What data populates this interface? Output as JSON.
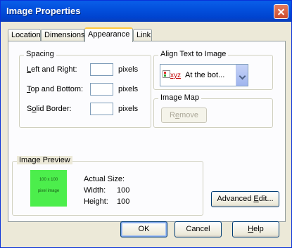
{
  "window": {
    "title": "Image Properties"
  },
  "tabs": [
    {
      "label": "Location",
      "active": false
    },
    {
      "label": "Dimensions",
      "active": false
    },
    {
      "label": "Appearance",
      "active": true
    },
    {
      "label": "Link",
      "active": false
    }
  ],
  "spacing": {
    "title": "Spacing",
    "left_right": {
      "label_ul": "L",
      "label_rest": "eft and Right:",
      "value": "",
      "unit": "pixels"
    },
    "top_bottom": {
      "label_ul": "T",
      "label_rest": "op and Bottom:",
      "value": "",
      "unit": "pixels"
    },
    "solid_border": {
      "label_pre": "S",
      "label_ul": "o",
      "label_rest": "lid Border:",
      "value": "",
      "unit": "pixels"
    }
  },
  "align": {
    "title": "Align Text to Image",
    "icon_text": "xyz",
    "selected": "At the bot..."
  },
  "image_map": {
    "title": "Image Map",
    "remove_pre": "R",
    "remove_ul": "e",
    "remove_rest": "move"
  },
  "preview": {
    "title": "Image Preview",
    "thumb_line1": "100 x 100",
    "thumb_line2": "pixel image",
    "actual_size_label": "Actual Size:",
    "width_label": "Width:",
    "width_value": "100",
    "height_label": "Height:",
    "height_value": "100",
    "thumb_color": "#4cee4c"
  },
  "buttons": {
    "advanced_edit": {
      "pre": "Advanced ",
      "ul": "E",
      "rest": "dit..."
    },
    "ok": "OK",
    "cancel": "Cancel",
    "help_ul": "H",
    "help_rest": "elp"
  }
}
